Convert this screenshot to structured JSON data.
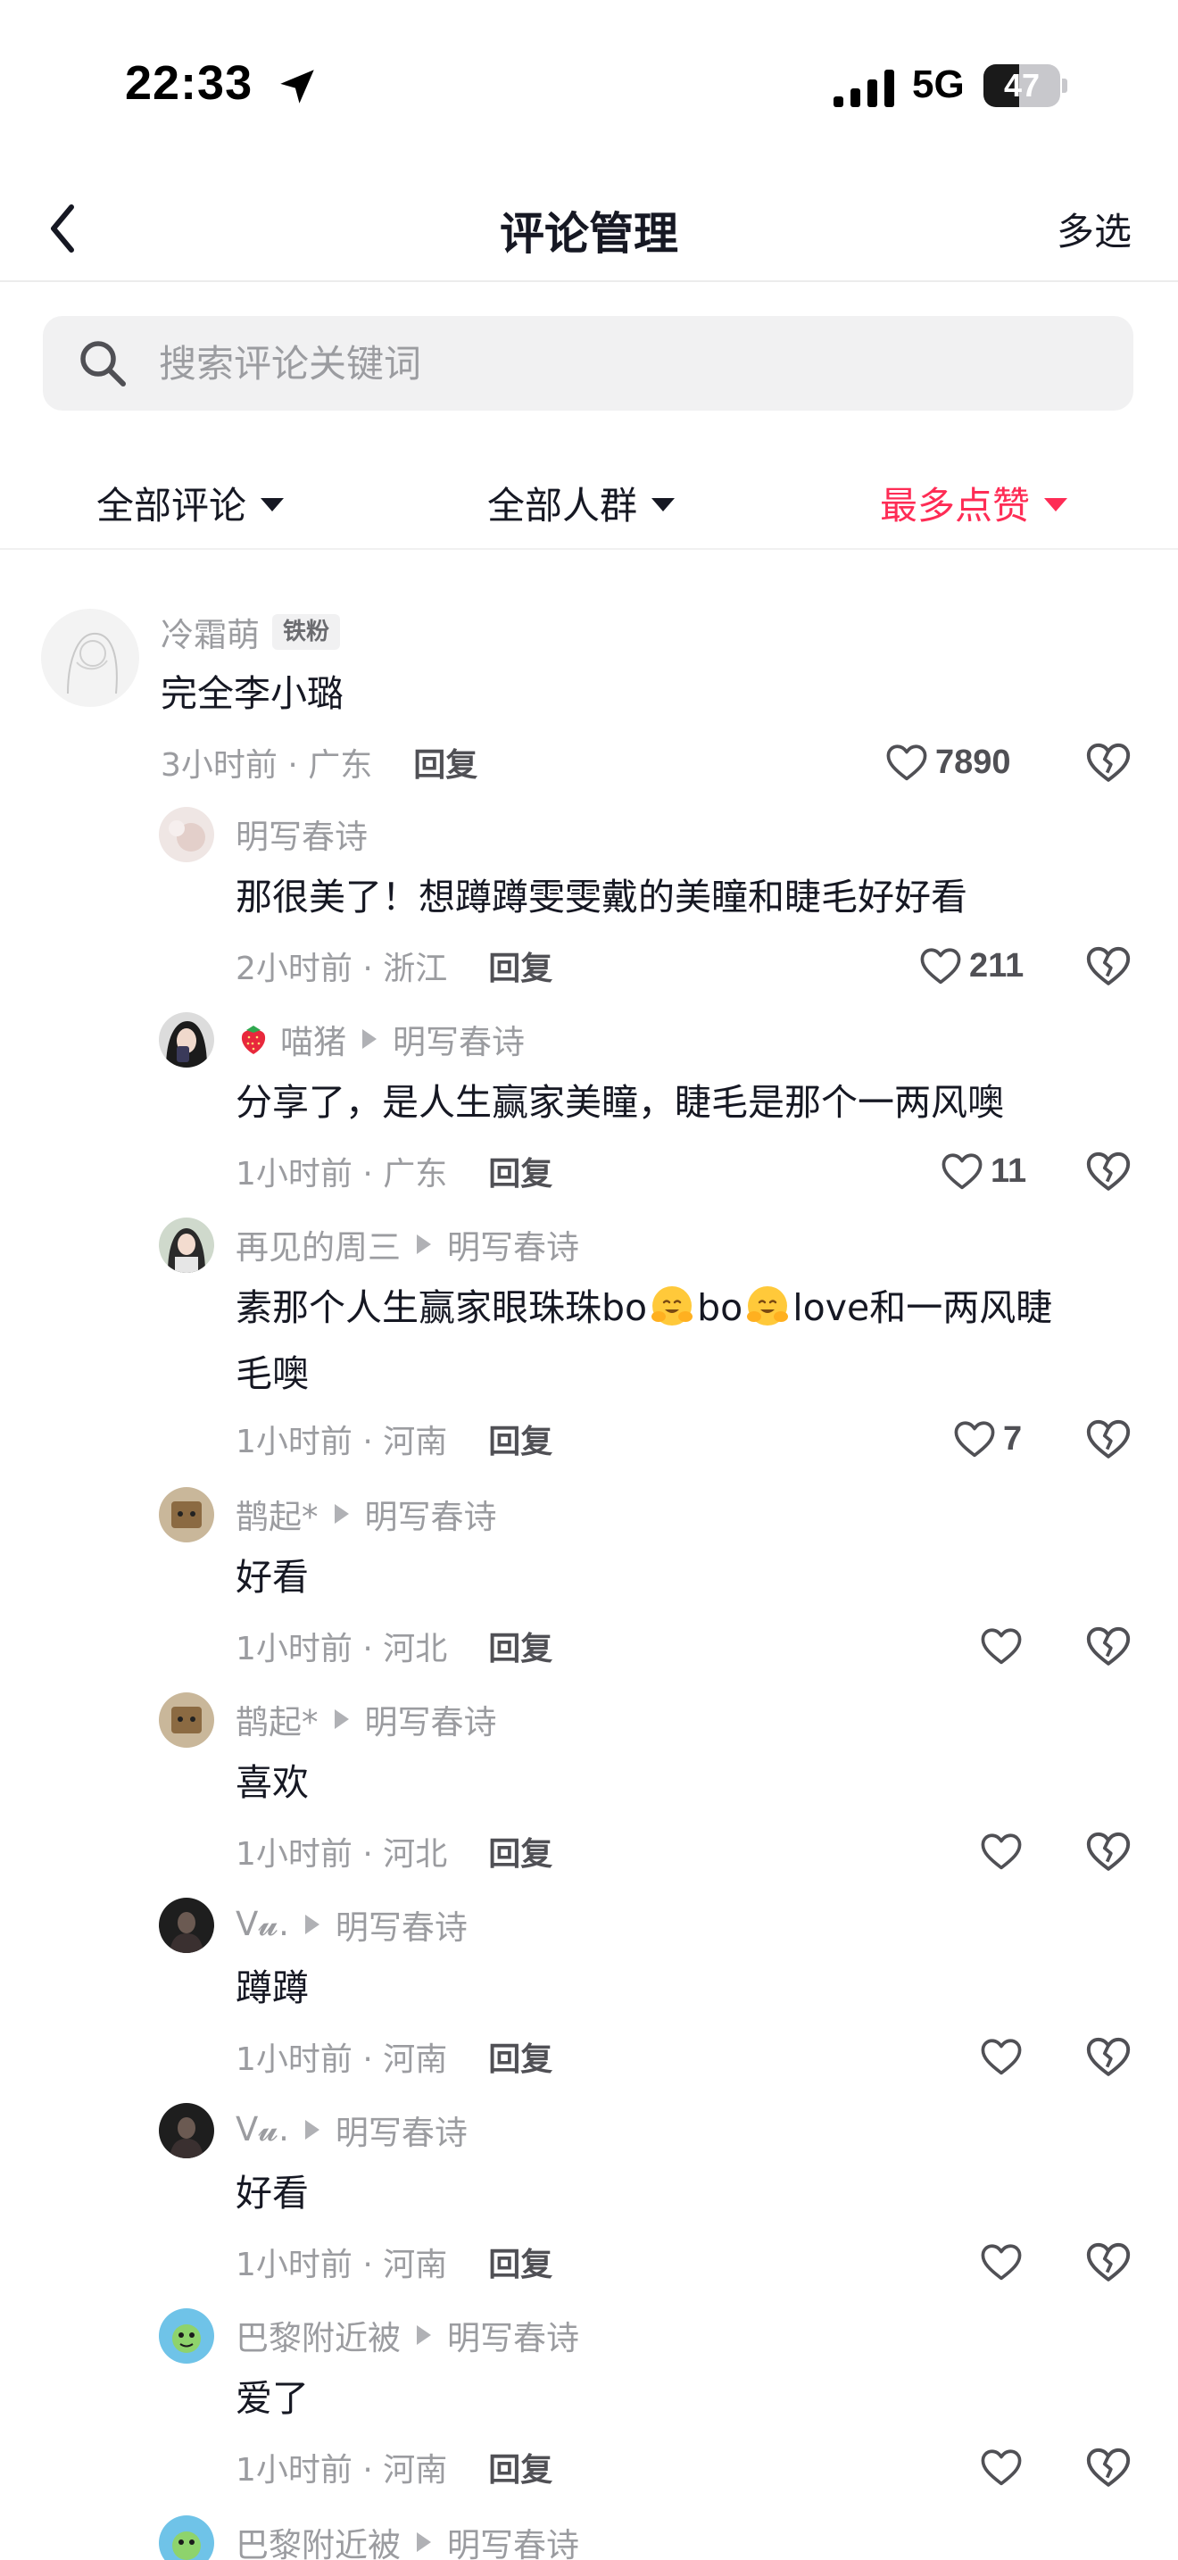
{
  "status_bar": {
    "time": "22:33",
    "network": "5G",
    "battery": "47",
    "battery_level": 0.47
  },
  "nav": {
    "title": "评论管理",
    "right_action": "多选"
  },
  "search": {
    "placeholder": "搜索评论关键词",
    "value": ""
  },
  "filters": [
    {
      "label": "全部评论",
      "active": false
    },
    {
      "label": "全部人群",
      "active": false
    },
    {
      "label": "最多点赞",
      "active": true
    }
  ],
  "colors": {
    "accent": "#fe2c55",
    "text": "#161823",
    "muted": "#9b9ca0"
  },
  "comments": [
    {
      "author": "冷霜萌",
      "badge": "铁粉",
      "reply_to": "",
      "text": "完全李小璐",
      "time_location": "3小时前 · 广东",
      "reply_label": "回复",
      "likes": "7890"
    },
    {
      "author": "明写春诗",
      "badge": "",
      "reply_to": "",
      "text": "那很美了！想蹲蹲雯雯戴的美瞳和睫毛好好看",
      "time_location": "2小时前 · 浙江",
      "reply_label": "回复",
      "likes": "211"
    },
    {
      "author": "喵猪",
      "badge": "",
      "reply_to": "明写春诗",
      "text": "分享了，是人生赢家美瞳，睫毛是那个一两风噢",
      "time_location": "1小时前 · 广东",
      "reply_label": "回复",
      "likes": "11"
    },
    {
      "author": "再见的周三",
      "badge": "",
      "reply_to": "明写春诗",
      "text_line1_a": "素那个人生赢家眼珠珠bo",
      "text_line1_b": "bo",
      "text_line1_c": "love和一两风睫",
      "text_line2": "毛噢",
      "time_location": "1小时前 · 河南",
      "reply_label": "回复",
      "likes": "7"
    },
    {
      "author": "鹊起*",
      "badge": "",
      "reply_to": "明写春诗",
      "text": "好看",
      "time_location": "1小时前 · 河北",
      "reply_label": "回复",
      "likes": ""
    },
    {
      "author": "鹊起*",
      "badge": "",
      "reply_to": "明写春诗",
      "text": "喜欢",
      "time_location": "1小时前 · 河北",
      "reply_label": "回复",
      "likes": ""
    },
    {
      "author": "V𝓾.",
      "badge": "",
      "reply_to": "明写春诗",
      "text": "蹲蹲",
      "time_location": "1小时前 · 河南",
      "reply_label": "回复",
      "likes": ""
    },
    {
      "author": "V𝓾.",
      "badge": "",
      "reply_to": "明写春诗",
      "text": "好看",
      "time_location": "1小时前 · 河南",
      "reply_label": "回复",
      "likes": ""
    },
    {
      "author": "巴黎附近被",
      "badge": "",
      "reply_to": "明写春诗",
      "text": "爱了",
      "time_location": "1小时前 · 河南",
      "reply_label": "回复",
      "likes": ""
    },
    {
      "author": "巴黎附近被",
      "badge": "",
      "reply_to": "明写春诗"
    }
  ]
}
